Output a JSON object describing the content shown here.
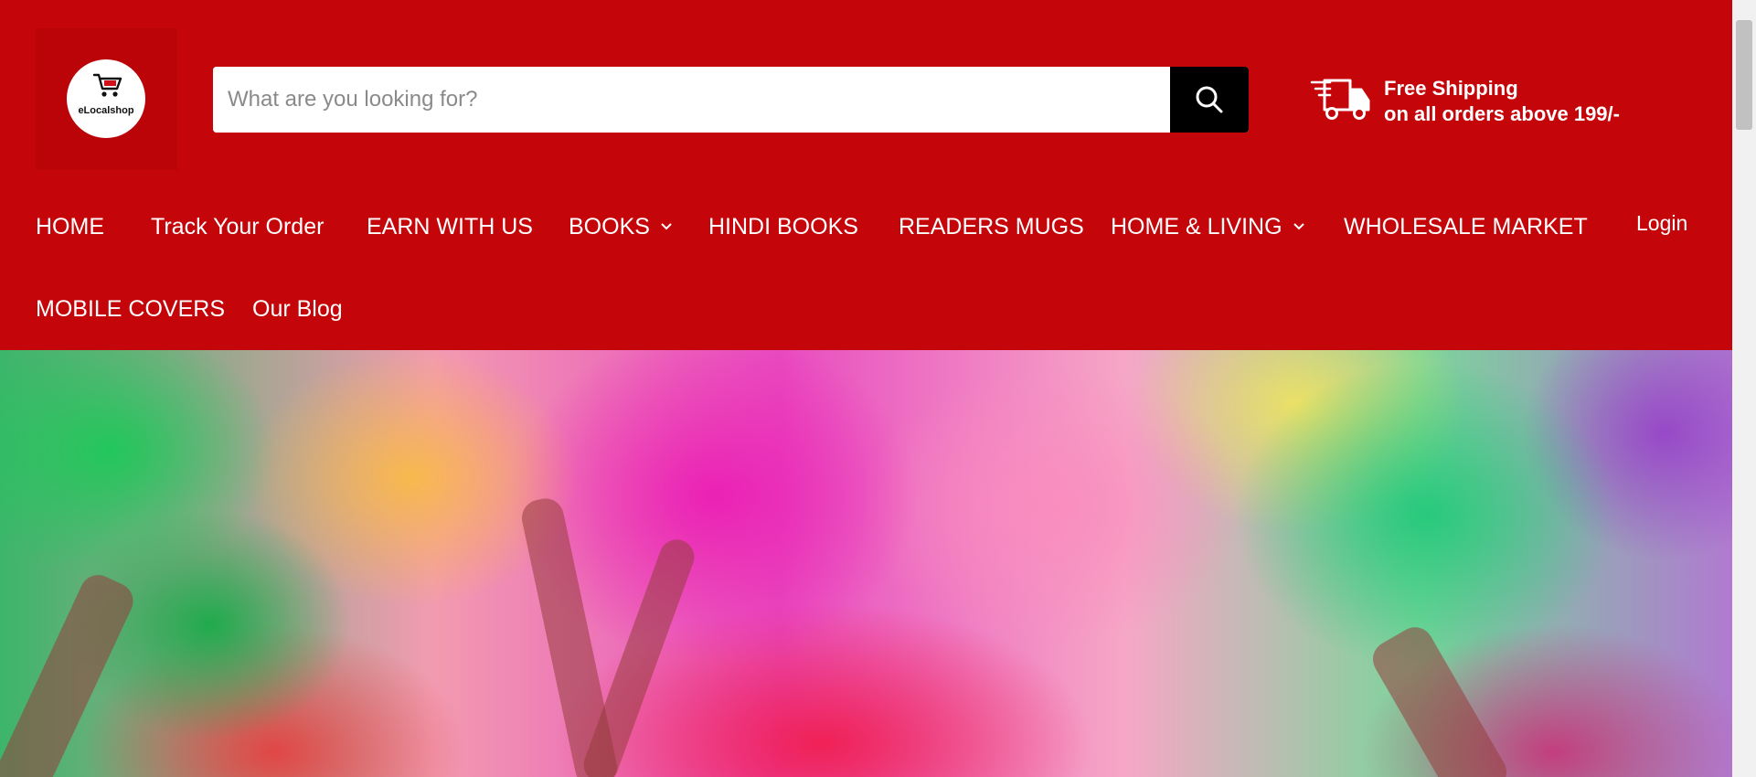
{
  "brand": {
    "logo_text": "eLocalshop",
    "primary_color": "#c4060a"
  },
  "search": {
    "placeholder": "What are you looking for?"
  },
  "shipping": {
    "title": "Free Shipping",
    "subtitle": "on all orders above 199/-"
  },
  "nav": {
    "items": [
      {
        "label": "HOME"
      },
      {
        "label": "Track Your Order"
      },
      {
        "label": "EARN WITH US"
      },
      {
        "label": "BOOKS",
        "has_dropdown": true
      },
      {
        "label": "HINDI BOOKS"
      },
      {
        "label": "READERS MUGS"
      },
      {
        "label": "HOME & LIVING",
        "has_dropdown": true
      },
      {
        "label": "WHOLESALE MARKET"
      },
      {
        "label": "MOBILE COVERS"
      },
      {
        "label": "Our Blog"
      }
    ],
    "login_label": "Login"
  },
  "icons": [
    "shopping-cart-icon",
    "search-icon",
    "delivery-truck-icon",
    "chevron-down-icon"
  ]
}
